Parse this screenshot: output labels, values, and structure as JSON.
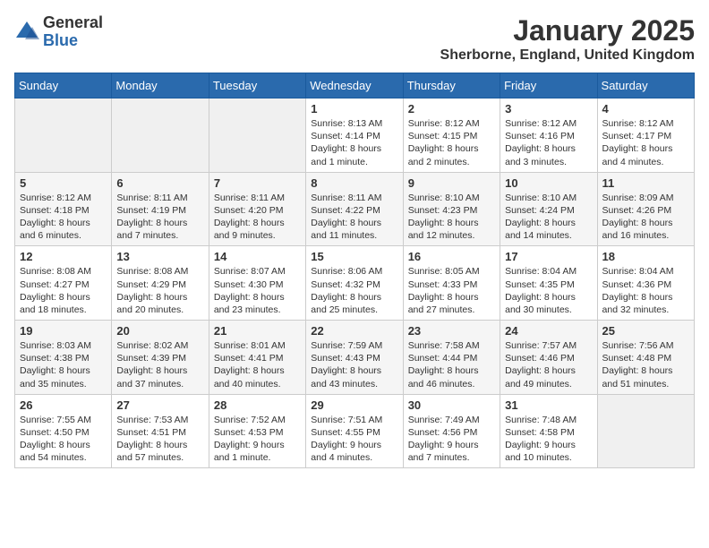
{
  "logo": {
    "general": "General",
    "blue": "Blue"
  },
  "title": "January 2025",
  "subtitle": "Sherborne, England, United Kingdom",
  "days_of_week": [
    "Sunday",
    "Monday",
    "Tuesday",
    "Wednesday",
    "Thursday",
    "Friday",
    "Saturday"
  ],
  "weeks": [
    [
      {
        "day": "",
        "info": ""
      },
      {
        "day": "",
        "info": ""
      },
      {
        "day": "",
        "info": ""
      },
      {
        "day": "1",
        "info": "Sunrise: 8:13 AM\nSunset: 4:14 PM\nDaylight: 8 hours\nand 1 minute."
      },
      {
        "day": "2",
        "info": "Sunrise: 8:12 AM\nSunset: 4:15 PM\nDaylight: 8 hours\nand 2 minutes."
      },
      {
        "day": "3",
        "info": "Sunrise: 8:12 AM\nSunset: 4:16 PM\nDaylight: 8 hours\nand 3 minutes."
      },
      {
        "day": "4",
        "info": "Sunrise: 8:12 AM\nSunset: 4:17 PM\nDaylight: 8 hours\nand 4 minutes."
      }
    ],
    [
      {
        "day": "5",
        "info": "Sunrise: 8:12 AM\nSunset: 4:18 PM\nDaylight: 8 hours\nand 6 minutes."
      },
      {
        "day": "6",
        "info": "Sunrise: 8:11 AM\nSunset: 4:19 PM\nDaylight: 8 hours\nand 7 minutes."
      },
      {
        "day": "7",
        "info": "Sunrise: 8:11 AM\nSunset: 4:20 PM\nDaylight: 8 hours\nand 9 minutes."
      },
      {
        "day": "8",
        "info": "Sunrise: 8:11 AM\nSunset: 4:22 PM\nDaylight: 8 hours\nand 11 minutes."
      },
      {
        "day": "9",
        "info": "Sunrise: 8:10 AM\nSunset: 4:23 PM\nDaylight: 8 hours\nand 12 minutes."
      },
      {
        "day": "10",
        "info": "Sunrise: 8:10 AM\nSunset: 4:24 PM\nDaylight: 8 hours\nand 14 minutes."
      },
      {
        "day": "11",
        "info": "Sunrise: 8:09 AM\nSunset: 4:26 PM\nDaylight: 8 hours\nand 16 minutes."
      }
    ],
    [
      {
        "day": "12",
        "info": "Sunrise: 8:08 AM\nSunset: 4:27 PM\nDaylight: 8 hours\nand 18 minutes."
      },
      {
        "day": "13",
        "info": "Sunrise: 8:08 AM\nSunset: 4:29 PM\nDaylight: 8 hours\nand 20 minutes."
      },
      {
        "day": "14",
        "info": "Sunrise: 8:07 AM\nSunset: 4:30 PM\nDaylight: 8 hours\nand 23 minutes."
      },
      {
        "day": "15",
        "info": "Sunrise: 8:06 AM\nSunset: 4:32 PM\nDaylight: 8 hours\nand 25 minutes."
      },
      {
        "day": "16",
        "info": "Sunrise: 8:05 AM\nSunset: 4:33 PM\nDaylight: 8 hours\nand 27 minutes."
      },
      {
        "day": "17",
        "info": "Sunrise: 8:04 AM\nSunset: 4:35 PM\nDaylight: 8 hours\nand 30 minutes."
      },
      {
        "day": "18",
        "info": "Sunrise: 8:04 AM\nSunset: 4:36 PM\nDaylight: 8 hours\nand 32 minutes."
      }
    ],
    [
      {
        "day": "19",
        "info": "Sunrise: 8:03 AM\nSunset: 4:38 PM\nDaylight: 8 hours\nand 35 minutes."
      },
      {
        "day": "20",
        "info": "Sunrise: 8:02 AM\nSunset: 4:39 PM\nDaylight: 8 hours\nand 37 minutes."
      },
      {
        "day": "21",
        "info": "Sunrise: 8:01 AM\nSunset: 4:41 PM\nDaylight: 8 hours\nand 40 minutes."
      },
      {
        "day": "22",
        "info": "Sunrise: 7:59 AM\nSunset: 4:43 PM\nDaylight: 8 hours\nand 43 minutes."
      },
      {
        "day": "23",
        "info": "Sunrise: 7:58 AM\nSunset: 4:44 PM\nDaylight: 8 hours\nand 46 minutes."
      },
      {
        "day": "24",
        "info": "Sunrise: 7:57 AM\nSunset: 4:46 PM\nDaylight: 8 hours\nand 49 minutes."
      },
      {
        "day": "25",
        "info": "Sunrise: 7:56 AM\nSunset: 4:48 PM\nDaylight: 8 hours\nand 51 minutes."
      }
    ],
    [
      {
        "day": "26",
        "info": "Sunrise: 7:55 AM\nSunset: 4:50 PM\nDaylight: 8 hours\nand 54 minutes."
      },
      {
        "day": "27",
        "info": "Sunrise: 7:53 AM\nSunset: 4:51 PM\nDaylight: 8 hours\nand 57 minutes."
      },
      {
        "day": "28",
        "info": "Sunrise: 7:52 AM\nSunset: 4:53 PM\nDaylight: 9 hours\nand 1 minute."
      },
      {
        "day": "29",
        "info": "Sunrise: 7:51 AM\nSunset: 4:55 PM\nDaylight: 9 hours\nand 4 minutes."
      },
      {
        "day": "30",
        "info": "Sunrise: 7:49 AM\nSunset: 4:56 PM\nDaylight: 9 hours\nand 7 minutes."
      },
      {
        "day": "31",
        "info": "Sunrise: 7:48 AM\nSunset: 4:58 PM\nDaylight: 9 hours\nand 10 minutes."
      },
      {
        "day": "",
        "info": ""
      }
    ]
  ]
}
